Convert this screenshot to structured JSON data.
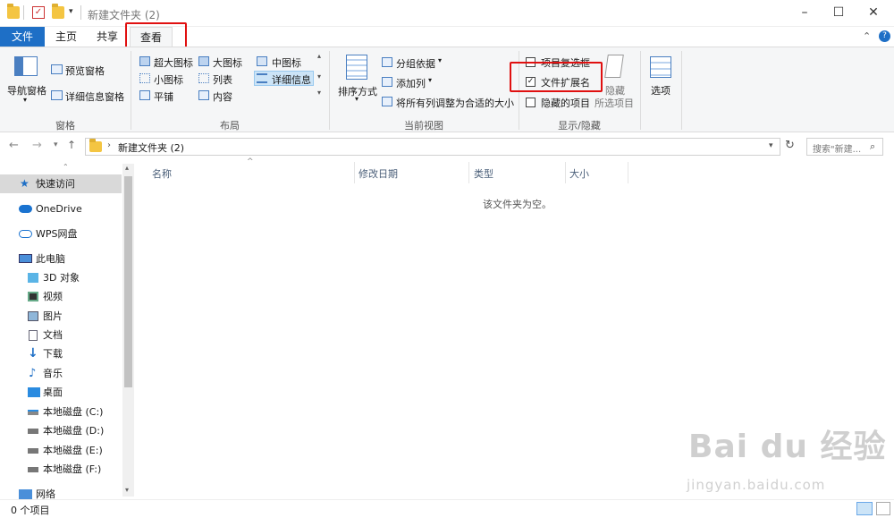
{
  "title": "新建文件夹 (2)",
  "ribbon_tabs": [
    "文件",
    "主页",
    "共享",
    "查看"
  ],
  "ribbon": {
    "pane_group": {
      "nav_pane": "导航窗格",
      "preview": "预览窗格",
      "details": "详细信息窗格",
      "label": "窗格"
    },
    "layout_group": {
      "items": [
        "超大图标",
        "大图标",
        "中图标",
        "小图标",
        "列表",
        "详细信息",
        "平铺",
        "内容"
      ],
      "label": "布局"
    },
    "current_view_group": {
      "sort_by": "排序方式",
      "group_by": "分组依据",
      "add_columns": "添加列",
      "fit_columns": "将所有列调整为合适的大小",
      "label": "当前视图"
    },
    "show_hide_group": {
      "item_checkboxes": "项目复选框",
      "file_extensions": "文件扩展名",
      "hidden_items": "隐藏的项目",
      "hide": "隐藏",
      "hide_sub": "所选项目",
      "label": "显示/隐藏",
      "file_extensions_checked": true
    },
    "options": "选项"
  },
  "address": {
    "path": "新建文件夹 (2)",
    "search_placeholder": "搜索\"新建..."
  },
  "nav": {
    "quick_access": "快速访问",
    "onedrive": "OneDrive",
    "wps": "WPS网盘",
    "this_pc": "此电脑",
    "pc_items": [
      "3D 对象",
      "视频",
      "图片",
      "文档",
      "下载",
      "音乐",
      "桌面",
      "本地磁盘 (C:)",
      "本地磁盘 (D:)",
      "本地磁盘 (E:)",
      "本地磁盘 (F:)"
    ],
    "network": "网络"
  },
  "columns": [
    "名称",
    "修改日期",
    "类型",
    "大小"
  ],
  "empty_message": "该文件夹为空。",
  "status": "0 个项目",
  "watermark": {
    "main": "Bai du 经验",
    "sub": "jingyan.baidu.com"
  },
  "colors": {
    "accent": "#1e6fc6",
    "highlight": "#e01010"
  }
}
